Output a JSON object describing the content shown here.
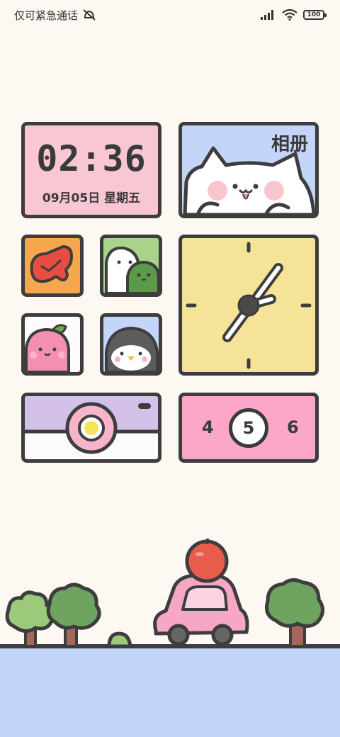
{
  "status_bar": {
    "carrier_text": "仅可紧急通话",
    "battery_level": "100",
    "icons": [
      "alarm-off-icon",
      "signal-icon",
      "wifi-icon",
      "battery-icon"
    ]
  },
  "clock_widget": {
    "time": "02:36",
    "date": "09月05日 星期五"
  },
  "album_widget": {
    "label": "相册"
  },
  "number_widget": {
    "left": "4",
    "center": "5",
    "right": "6"
  },
  "colors": {
    "background": "#fdf8f1",
    "clock_bg": "#f9c6d4",
    "album_bg": "#c3d6f9",
    "analog_bg": "#f5e397",
    "number_bg": "#fca6c9",
    "camera_top": "#d3c1ea",
    "ground": "#c3d6f9",
    "outline": "#3d3d3d"
  }
}
